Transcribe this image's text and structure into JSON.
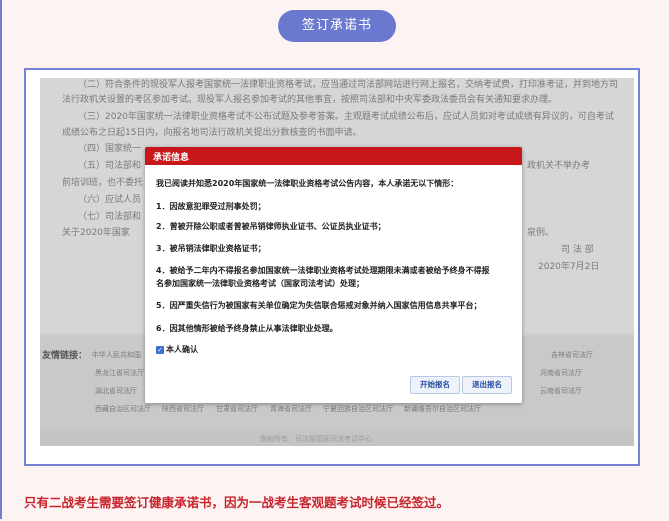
{
  "header": {
    "pill_label": "签订承诺书"
  },
  "background_doc": {
    "lines": [
      "（二）符合条件的现役军人报考国家统一法律职业资格考试，应当通过司法部网站进行网上报名，交纳考试费，打印准考证，并到地方司",
      "法行政机关设置的考区参加考试。现役军人报名参加考试的其他事宜，按照司法部和中央军委政法委员会有关通知要求办理。",
      "（三）2020年国家统一法律职业资格考试不公布试题及参考答案。主观题考试成绩公布后，应试人员如对考试成绩有异议的，可自考试",
      "成绩公布之日起15日内，向报名地司法行政机关提出分数核查的书面申请。",
      "（四）国家统一",
      "（五）司法部和",
      "前培训班，也不委托",
      "（六）应试人员",
      "（七）司法部和",
      "关于2020年国家"
    ],
    "right_fragments": [
      "政机关不举办考",
      "泉例。",
      "司 法 部",
      "2020年7月2日"
    ]
  },
  "footer_links": {
    "title": "友情链接：",
    "items": [
      "中华人民共和国",
      "黑龙江省司法厅",
      "湖北省司法厅",
      "西藏自治区司法厅",
      "陕西省司法厅",
      "甘肃省司法厅",
      "青海省司法厅",
      "宁夏回族自治区司法厅",
      "新疆维吾尔自治区司法厅",
      "吉林省司法厅",
      "河南省司法厅",
      "云南省司法厅"
    ],
    "copyright": "版权所有：司法部国家司法考试中心"
  },
  "modal": {
    "title": "承诺信息",
    "intro": "我已阅读并知悉2020年国家统一法律职业资格考试公告内容，本人承诺无以下情形：",
    "items": [
      "1．因故意犯罪受过刑事处罚；",
      "2．曾被开除公职或者曾被吊销律师执业证书、公证员执业证书；",
      "3．被吊销法律职业资格证书；",
      "4．被给予二年内不得报名参加国家统一法律职业资格考试处理期限未满或者被给予终身不得报",
      "名参加国家统一法律职业资格考试（国家司法考试）处理；",
      "5．因严重失信行为被国家有关单位确定为失信联合惩戒对象并纳入国家信用信息共享平台；",
      "6．因其他情形被给予终身禁止从事法律职业处理。"
    ],
    "confirm_label": "本人确认",
    "confirm_checked": true,
    "buttons": {
      "start": "开始报名",
      "exit": "退出报名"
    }
  },
  "caption": "只有二战考生需要签订健康承诺书，因为一战考生客观题考试时候已经签过。",
  "colors": {
    "accent": "#6a79cf",
    "modal_header": "#c8171b",
    "caption": "#c8252d",
    "background": "#fdf3f3"
  }
}
